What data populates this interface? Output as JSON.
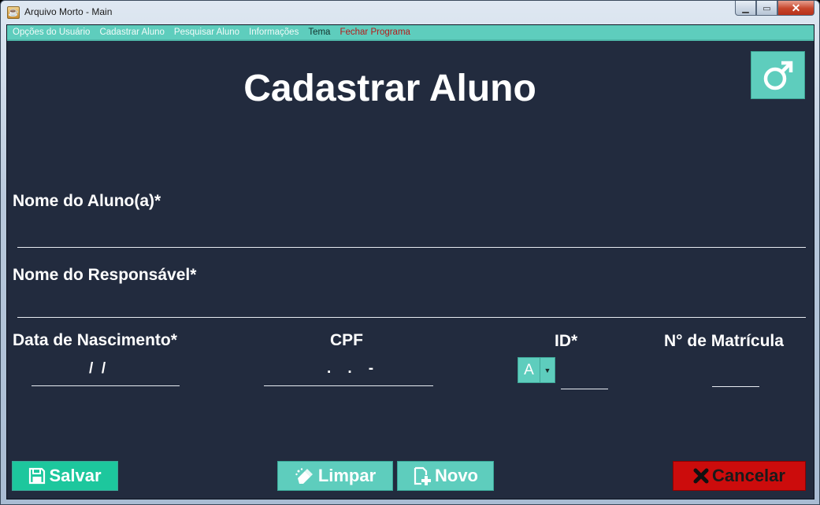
{
  "window": {
    "title": "Arquivo Morto - Main",
    "controls": {
      "minimize": "▁",
      "maximize": "▭",
      "close": "✕"
    }
  },
  "menu": [
    {
      "label": "Opções do Usuário",
      "style": "light"
    },
    {
      "label": "Cadastrar Aluno",
      "style": "light"
    },
    {
      "label": "Pesquisar Aluno",
      "style": "light"
    },
    {
      "label": "Informações",
      "style": "light"
    },
    {
      "label": "Tema",
      "style": "dark"
    },
    {
      "label": "Fechar Programa",
      "style": "red"
    }
  ],
  "page": {
    "title": "Cadastrar Aluno",
    "gender_icon": "male-symbol-icon"
  },
  "form": {
    "student_name_label": "Nome do Aluno(a)*",
    "student_name_value": "",
    "guardian_name_label": "Nome do Responsável*",
    "guardian_name_value": "",
    "birth_date_label": "Data de Nascimento*",
    "birth_date_mask": "/  /",
    "cpf_label": "CPF",
    "cpf_mask": ".    .    -",
    "id_label": "ID*",
    "id_prefix_selected": "A",
    "id_value": "",
    "registration_label": "N° de Matrícula",
    "registration_value": ""
  },
  "buttons": {
    "save": {
      "label": "Salvar",
      "icon": "floppy-disk-icon"
    },
    "clear": {
      "label": "Limpar",
      "icon": "eraser-icon"
    },
    "new": {
      "label": "Novo",
      "icon": "new-document-icon"
    },
    "cancel": {
      "label": "Cancelar",
      "icon": "x-mark-icon"
    }
  },
  "colors": {
    "background": "#222b3e",
    "accent": "#5ecdbd",
    "save": "#1dc79d",
    "cancel": "#cc0c0c",
    "menu_red": "#b51b1b",
    "text": "#ffffff"
  }
}
